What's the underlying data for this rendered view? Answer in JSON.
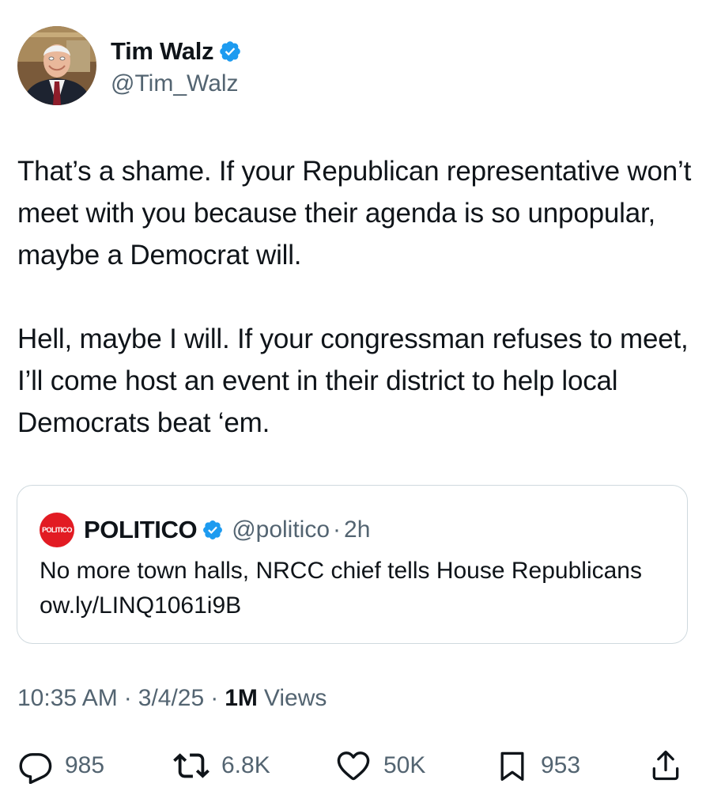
{
  "author": {
    "display_name": "Tim Walz",
    "handle": "@Tim_Walz",
    "verified": true,
    "avatar_icon": "profile-photo"
  },
  "tweet": {
    "paragraphs": [
      "That’s a shame. If your Republican representative won’t meet with you because their agenda is so unpopular, maybe a Democrat will.",
      "Hell, maybe I will. If your congressman refuses to meet, I’ll come host an event in their district to help local Democrats beat ‘em."
    ]
  },
  "quote": {
    "logo_text": "POLITICO",
    "display_name": "POLITICO",
    "handle": "@politico",
    "separator": "·",
    "age": "2h",
    "text": "No more town halls, NRCC chief tells House Republicans ow.ly/LINQ1061i9B"
  },
  "meta": {
    "time": "10:35 AM",
    "date": "3/4/25",
    "separator": "·",
    "views_count": "1M",
    "views_label": "Views"
  },
  "actions": {
    "replies": "985",
    "reposts": "6.8K",
    "likes": "50K",
    "bookmarks": "953"
  },
  "colors": {
    "text_primary": "#0f1419",
    "text_secondary": "#536471",
    "verified_blue": "#1d9bf0",
    "border": "#cfd9de",
    "politico_red": "#e21b23"
  }
}
